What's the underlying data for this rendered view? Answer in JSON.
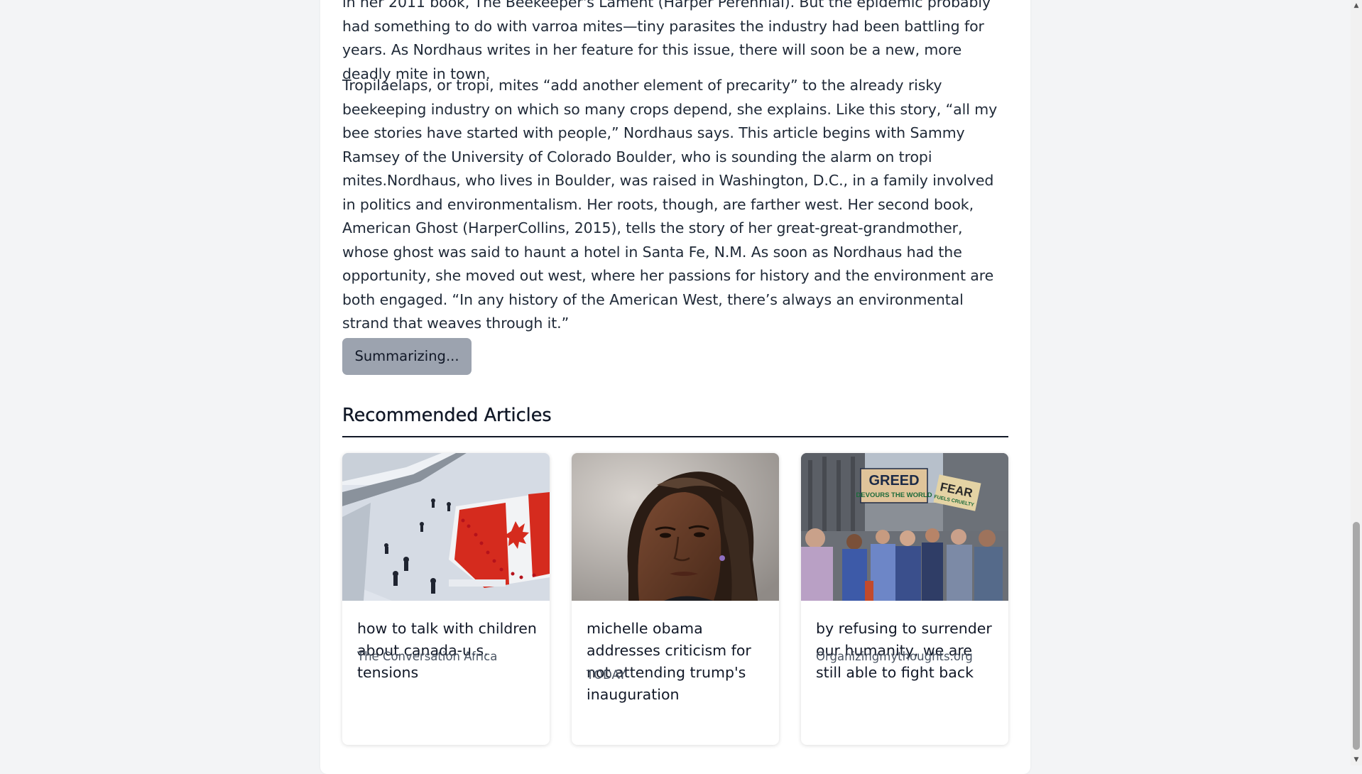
{
  "article": {
    "paragraph_1": "in her 2011 book, The Beekeeper's Lament (Harper Perennial). But the epidemic probably had something to do with varroa mites—tiny parasites the industry had been battling for years. As Nordhaus writes in her feature for this issue, there will soon be a new, more deadly mite in town.",
    "paragraph_2": "Tropilaelaps, or tropi, mites “add another element of precarity” to the already risky beekeeping industry on which so many crops depend, she explains. Like this story, “all my bee stories have started with people,” Nordhaus says. This article begins with Sammy Ramsey of the University of Colorado Boulder, who is sounding the alarm on tropi mites.Nordhaus, who lives in Boulder, was raised in Washington, D.C., in a family involved in politics and environmentalism. Her roots, though, are farther west. Her second book, American Ghost (HarperCollins, 2015), tells the story of her great-great-grandmother, whose ghost was said to haunt a hotel in Santa Fe, N.M. As soon as Nordhaus had the opportunity, she moved out west, where her passions for history and the environment are both engaged. “In any history of the American West, there’s always an environmental strand that weaves through it.”"
  },
  "summarize_button": {
    "label": "Summarizing..."
  },
  "recommended": {
    "heading": "Recommended Articles",
    "articles": [
      {
        "title": "how to talk with children about canada-u.s. tensions",
        "source": "The Conversation Africa",
        "image": "snowy-plaza-canadian-flag-photo"
      },
      {
        "title": "michelle obama addresses criticism for not attending trump's inauguration",
        "source": "TODAY",
        "image": "woman-portrait-photo"
      },
      {
        "title": "by refusing to surrender our humanity, we are still able to fight back",
        "source": "Organizingmythoughts.org",
        "image": "street-protest-signs-photo"
      }
    ],
    "sign_texts": [
      "GREED",
      "DEVOURS THE WORLD",
      "FEAR",
      "FUELS CRUELTY"
    ]
  },
  "colors": {
    "page_background": "#f3f4f6",
    "card_background": "#ffffff",
    "button_background": "#9ca3af",
    "rule": "#111827",
    "flag_red": "#d52b1e"
  }
}
